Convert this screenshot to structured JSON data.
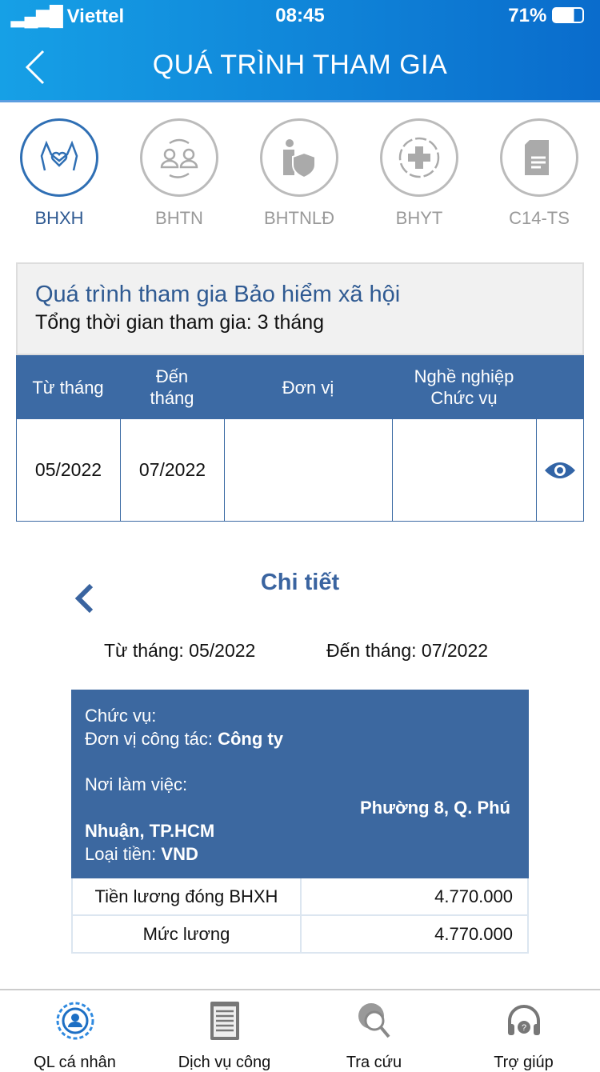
{
  "status": {
    "carrier": "Viettel",
    "time": "08:45",
    "battery": "71%"
  },
  "header": {
    "title": "QUÁ TRÌNH THAM GIA",
    "back": "back"
  },
  "tabs": [
    {
      "label": "BHXH",
      "icon": "hands-heart-icon",
      "active": true
    },
    {
      "label": "BHTN",
      "icon": "people-exchange-icon"
    },
    {
      "label": "BHTNLĐ",
      "icon": "worker-shield-icon"
    },
    {
      "label": "BHYT",
      "icon": "medical-cross-icon"
    },
    {
      "label": "C14-TS",
      "icon": "document-icon"
    }
  ],
  "summary": {
    "title": "Quá trình tham gia Bảo hiểm xã hội",
    "total": "Tổng thời gian tham gia: 3 tháng"
  },
  "table": {
    "headers": [
      "Từ tháng",
      "Đến\ntháng",
      "Đơn vị",
      "Nghề nghiệp\nChức vụ"
    ],
    "rows": [
      {
        "from": "05/2022",
        "to": "07/2022",
        "unit": "",
        "job": ""
      }
    ]
  },
  "detail": {
    "title": "Chi tiết",
    "from": "Từ tháng: 05/2022",
    "to": "Đến tháng: 07/2022",
    "position_label": "Chức vụ:",
    "unit_label": "Đơn vị công tác: ",
    "unit_value": "Công ty",
    "workplace_label": "Nơi làm việc:",
    "workplace_value1": "Phường 8, Q. Phú",
    "workplace_value2": "Nhuận, TP.HCM",
    "currency_label": "Loại tiền: ",
    "currency_value": "VND",
    "salary": [
      {
        "label": "Tiền lương đóng BHXH",
        "value": "4.770.000"
      },
      {
        "label": "Mức lương",
        "value": "4.770.000"
      }
    ]
  },
  "bottom_nav": [
    {
      "label": "QL cá nhân",
      "icon": "user-gear-icon"
    },
    {
      "label": "Dịch vụ công",
      "icon": "clipboard-icon"
    },
    {
      "label": "Tra cứu",
      "icon": "globe-search-icon"
    },
    {
      "label": "Trợ giúp",
      "icon": "headset-help-icon"
    }
  ],
  "colors": {
    "primary": "#3c6aa4",
    "header": "#0a6ccc"
  }
}
